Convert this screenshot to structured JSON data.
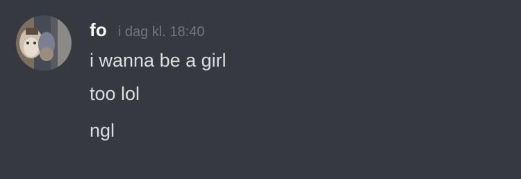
{
  "message": {
    "author": {
      "name": "fo",
      "avatar_icon": "user-avatar"
    },
    "timestamp": "i dag kl. 18:40",
    "lines": [
      "i wanna be a girl",
      "too lol",
      "ngl"
    ]
  },
  "colors": {
    "background": "#36393f",
    "username": "#ffffff",
    "timestamp": "#72767d",
    "message_text": "#dcddde"
  }
}
